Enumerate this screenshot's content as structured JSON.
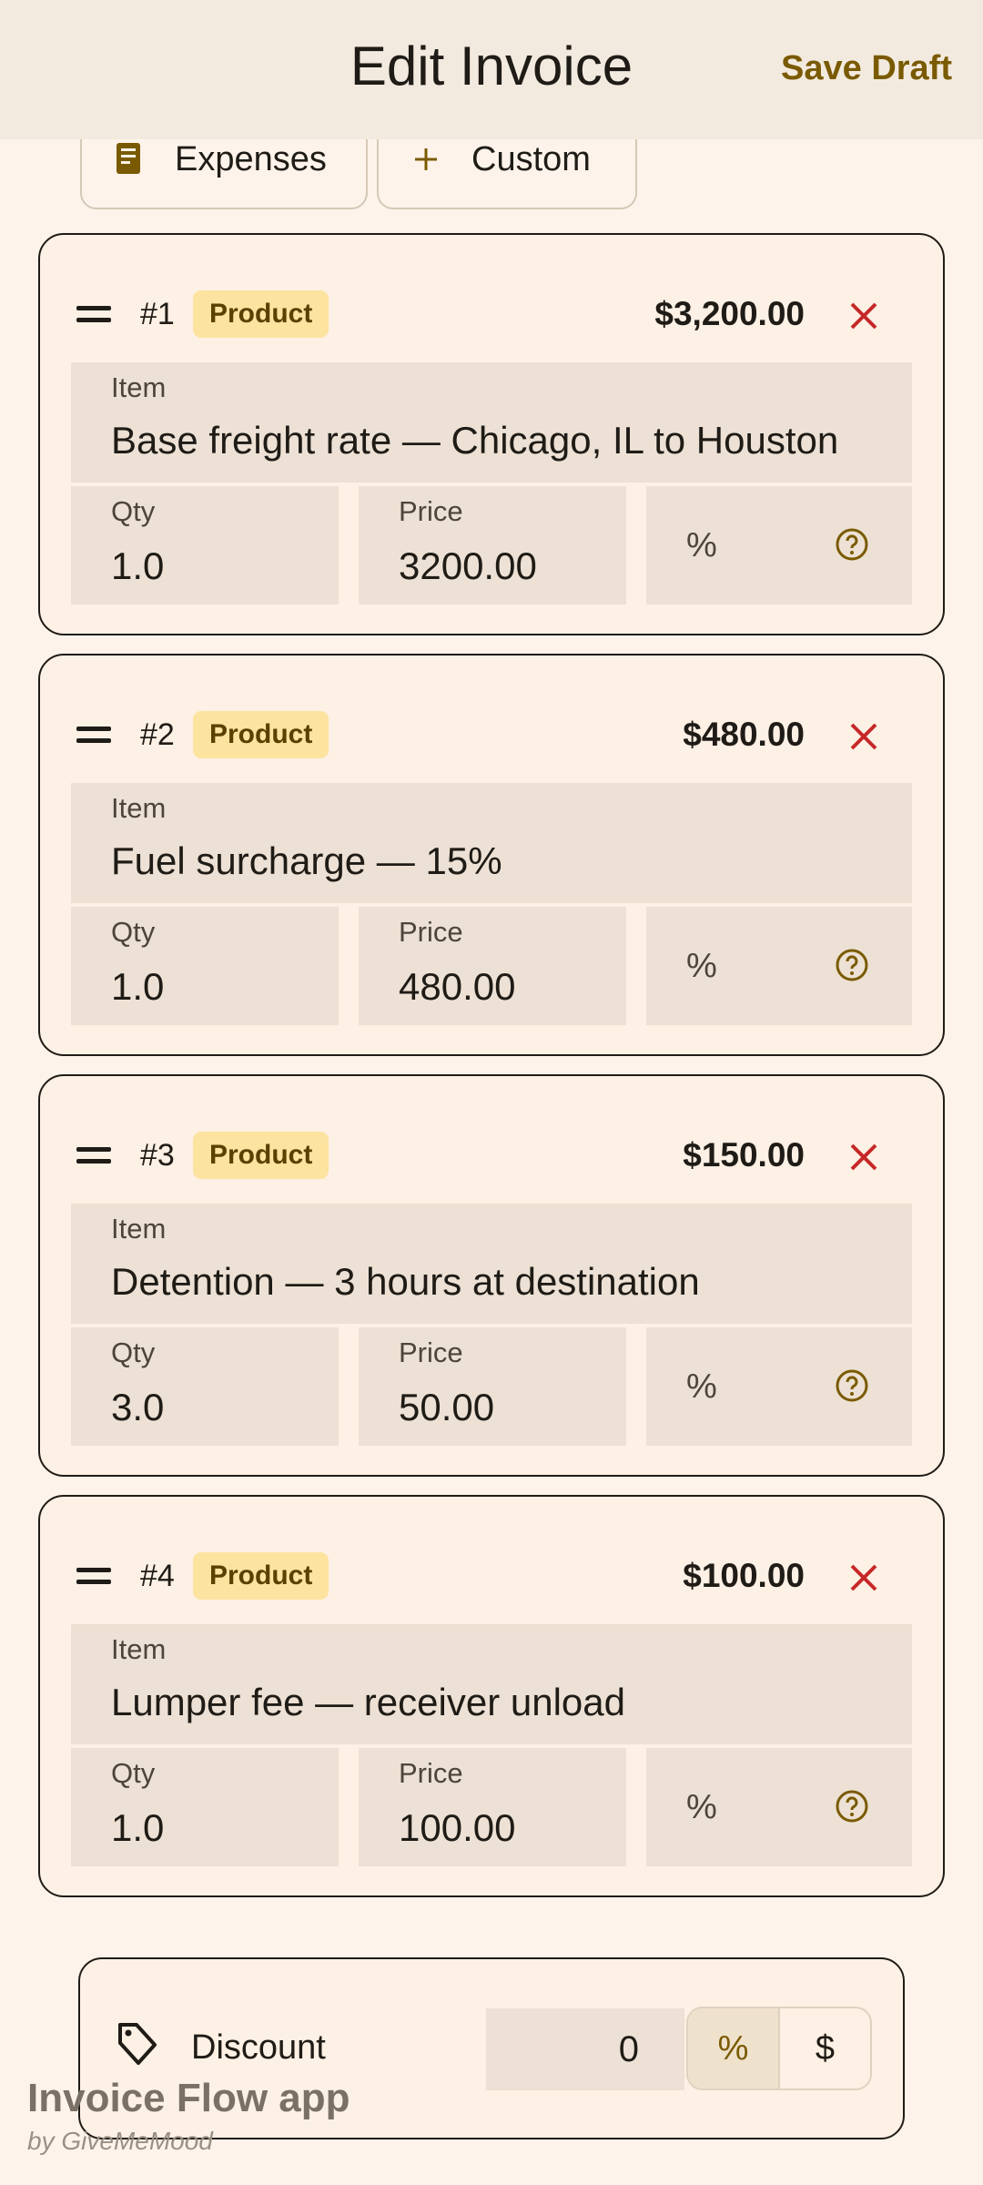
{
  "appbar": {
    "title": "Edit Invoice",
    "save_label": "Save Draft"
  },
  "chips": [
    {
      "label": "Expenses",
      "icon": "receipt-icon"
    },
    {
      "label": "Custom",
      "icon": "plus-icon"
    }
  ],
  "items": [
    {
      "index": "#1",
      "type": "Product",
      "total": "$3,200.00",
      "item_label": "Item",
      "item": "Base freight rate — Chicago, IL to Houston",
      "qty_label": "Qty",
      "qty": "1.0",
      "price_label": "Price",
      "price": "3200.00",
      "pct": "%"
    },
    {
      "index": "#2",
      "type": "Product",
      "total": "$480.00",
      "item_label": "Item",
      "item": "Fuel surcharge — 15%",
      "qty_label": "Qty",
      "qty": "1.0",
      "price_label": "Price",
      "price": "480.00",
      "pct": "%"
    },
    {
      "index": "#3",
      "type": "Product",
      "total": "$150.00",
      "item_label": "Item",
      "item": "Detention — 3 hours at destination",
      "qty_label": "Qty",
      "qty": "3.0",
      "price_label": "Price",
      "price": "50.00",
      "pct": "%"
    },
    {
      "index": "#4",
      "type": "Product",
      "total": "$100.00",
      "item_label": "Item",
      "item": "Lumper fee — receiver unload",
      "qty_label": "Qty",
      "qty": "1.0",
      "price_label": "Price",
      "price": "100.00",
      "pct": "%"
    }
  ],
  "discount": {
    "label": "Discount",
    "value": "0",
    "mode_percent": "%",
    "mode_dollar": "$",
    "selected": "%"
  },
  "watermark": {
    "title": "Invoice Flow app",
    "subtitle": "by GiveMeMood"
  },
  "colors": {
    "accent": "#7a5a00",
    "badge": "#fde3a0",
    "danger": "#c62828",
    "field": "#ece1d4"
  }
}
